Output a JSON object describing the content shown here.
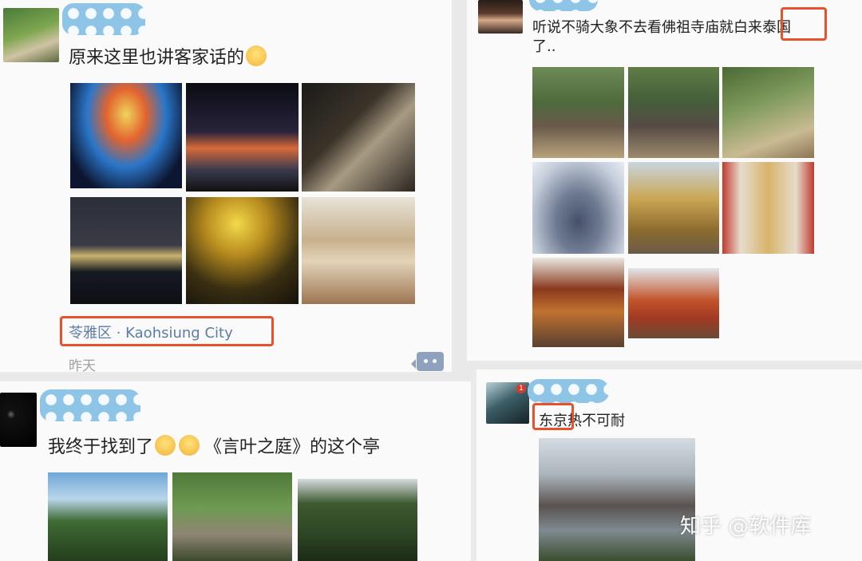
{
  "posts": [
    {
      "text": "原来这里也讲客家话的",
      "emoji": "laughing-tears-emoji",
      "location": "苓雅区 · Kaohsiung City",
      "time": "昨天"
    },
    {
      "text_line1": "听说不骑大象不去看佛祖寺庙就白来泰国",
      "text_line2": "了..",
      "highlight": "泰国"
    },
    {
      "text_before": "我终于找到了",
      "text_after": "《言叶之庭》的这个亭",
      "emoji": "crying-emoji"
    },
    {
      "text_highlight": "东京",
      "text_rest": "热不可耐",
      "avatar_badge": "1"
    }
  ],
  "watermark": "知乎 @软件库",
  "colors": {
    "highlight_box": "#e5522b",
    "location_text": "#5b7ca8",
    "name_blur": "#8ec4e6"
  }
}
